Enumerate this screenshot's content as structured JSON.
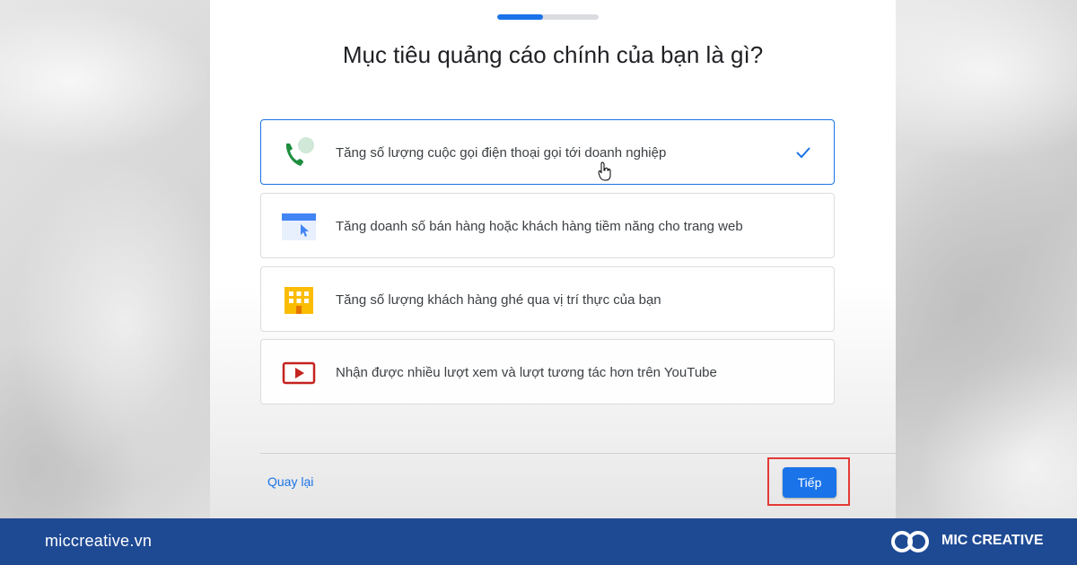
{
  "wizard": {
    "progress_fraction": 0.45,
    "title": "Mục tiêu quảng cáo chính của bạn là gì?",
    "options": [
      {
        "label": "Tăng số lượng cuộc gọi điện thoại gọi tới doanh nghiệp",
        "icon": "phone-call-icon",
        "selected": true
      },
      {
        "label": "Tăng doanh số bán hàng hoặc khách hàng tiềm năng cho trang web",
        "icon": "website-icon",
        "selected": false
      },
      {
        "label": "Tăng số lượng khách hàng ghé qua vị trí thực của bạn",
        "icon": "storefront-icon",
        "selected": false
      },
      {
        "label": "Nhận được nhiều lượt xem và lượt tương tác hơn trên YouTube",
        "icon": "youtube-play-icon",
        "selected": false
      }
    ],
    "back_label": "Quay lại",
    "next_label": "Tiếp"
  },
  "footer": {
    "site": "miccreative.vn",
    "brand": "MIC CREATIVE"
  },
  "colors": {
    "accent": "#1a73e8",
    "footer_bg": "#1e4a94",
    "highlight": "#e53935"
  }
}
